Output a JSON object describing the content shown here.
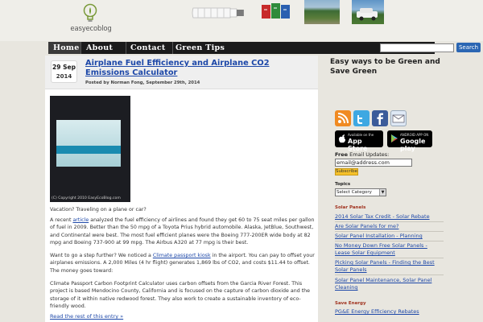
{
  "header": {
    "logo_text": "easyecoblog"
  },
  "nav": {
    "items": [
      "Home",
      "About",
      "Contact",
      "Green Tips"
    ],
    "search_button": "Search"
  },
  "post": {
    "date_day_month": "29 Sep",
    "date_year": "2014",
    "title": "Airplane Fuel Efficiency and Airplane CO2 Emissions Calculator",
    "meta": "Posted by Norman Fong, September 29th, 2014",
    "image_caption": "(C) Copyright 2010 EasyEcoBlog.com",
    "para1": "Vacation? Traveling on a plane or car?",
    "para2_pre": "A recent ",
    "para2_link": "article",
    "para2_post": " analyzed the fuel efficiency of airlines and found they get 60 to 75 seat miles per gallon of fuel in 2009.  Better than the 50 mpg of a Toyota Prius hybrid automobile. Alaska, JetBlue, Southwest, and Continental were best.  The most fuel efficient planes were the Boeing 777-200ER wide body at 82 mpg and Boeing 737-900 at 99 mpg.  The Airbus A320 at 77 mpg is their best.",
    "para3_pre": "Want to go a step further? We noticed a ",
    "para3_link": "Climate passport kiosk",
    "para3_post": " in the airport.  You can pay to offset your airplanes emissions. A 2,000 Miles (4 hr flight) generates 1,869 lbs of  CO2, and costs $11.44 to offset. The money goes toward:",
    "para4": "Climate Passport Carbon Footprint Calculator uses carbon offsets from the Garcia River Forest. This project is based Mendocino County, California and is focused on the capture of carbon dioxide and the storage of it within native redwood forest. They also work to create a sustainable inventory of eco-friendly wood.",
    "read_more": "Read the rest of this entry »"
  },
  "sidebar": {
    "heading": "Easy ways to be Green and Save Green",
    "app_store_small": "Available on the",
    "app_store_big": "App Store",
    "google_play_small": "ANDROID APP ON",
    "google_play_big": "Google play",
    "email_label_bold": "Free",
    "email_label_rest": " Email Updates:",
    "email_value": "email@address.com",
    "subscribe": "Subscribe",
    "topics_label": "Topics",
    "topics_selected": "Select Category",
    "solar_title": "Solar Panels",
    "solar_links": [
      "2014 Solar Tax Credit - Solar Rebate",
      "Are Solar Panels for me?",
      "Solar Panel Installation - Planning",
      "No Money Down Free Solar Panels - Lease Solar Equipment",
      "Picking Solar Panels - Finding the Best Solar Panels",
      "Solar Panel Maintenance, Solar Panel Cleaning"
    ],
    "save_energy_title": "Save Energy",
    "save_energy_links": [
      "PG&E Energy Efficiency Rebates"
    ]
  }
}
